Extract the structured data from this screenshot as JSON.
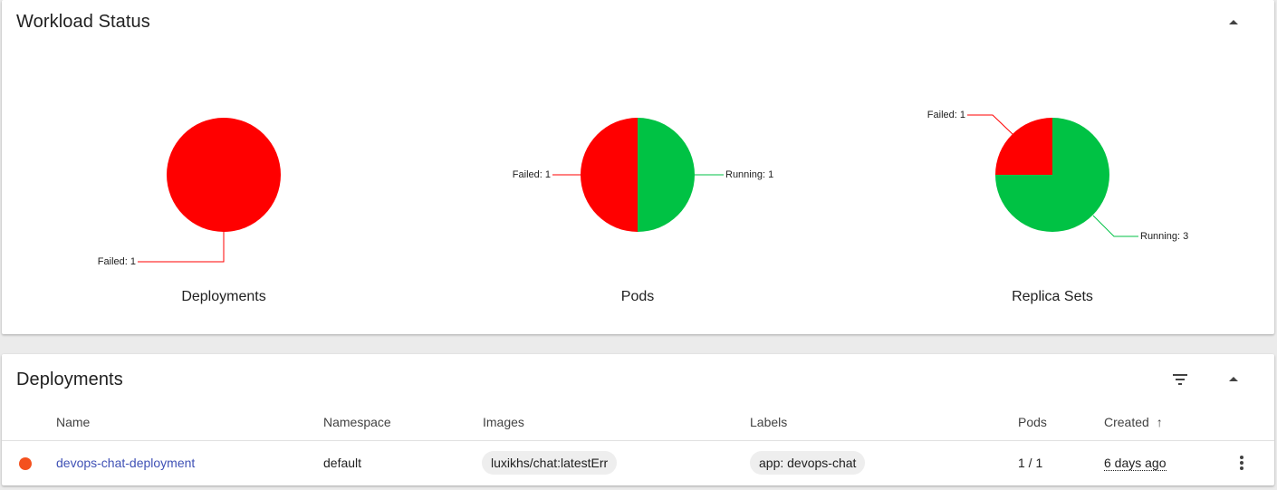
{
  "workload": {
    "title": "Workload Status",
    "charts": [
      {
        "title": "Deployments",
        "slices": [
          {
            "label": "Failed: 1",
            "value": 1,
            "color": "#ff0000"
          }
        ]
      },
      {
        "title": "Pods",
        "slices": [
          {
            "label": "Running: 1",
            "value": 1,
            "color": "#00c244"
          },
          {
            "label": "Failed: 1",
            "value": 1,
            "color": "#ff0000"
          }
        ]
      },
      {
        "title": "Replica Sets",
        "slices": [
          {
            "label": "Running: 3",
            "value": 3,
            "color": "#00c244"
          },
          {
            "label": "Failed: 1",
            "value": 1,
            "color": "#ff0000"
          }
        ]
      }
    ]
  },
  "chart_data": [
    {
      "type": "pie",
      "title": "Deployments",
      "categories": [
        "Failed"
      ],
      "values": [
        1
      ]
    },
    {
      "type": "pie",
      "title": "Pods",
      "categories": [
        "Running",
        "Failed"
      ],
      "values": [
        1,
        1
      ]
    },
    {
      "type": "pie",
      "title": "Replica Sets",
      "categories": [
        "Running",
        "Failed"
      ],
      "values": [
        3,
        1
      ]
    }
  ],
  "deployments": {
    "title": "Deployments",
    "columns": {
      "name": "Name",
      "namespace": "Namespace",
      "images": "Images",
      "labels": "Labels",
      "pods": "Pods",
      "created": "Created",
      "sort_indicator": "↑"
    },
    "rows": [
      {
        "status": "error",
        "status_color": "#f4511e",
        "name": "devops-chat-deployment",
        "namespace": "default",
        "image": "luxikhs/chat:latestErr",
        "label": "app: devops-chat",
        "pods": "1 / 1",
        "created": "6 days ago"
      }
    ]
  },
  "icons": {
    "collapse": "collapse-icon",
    "filter": "filter-icon",
    "more": "more-vert-icon"
  }
}
